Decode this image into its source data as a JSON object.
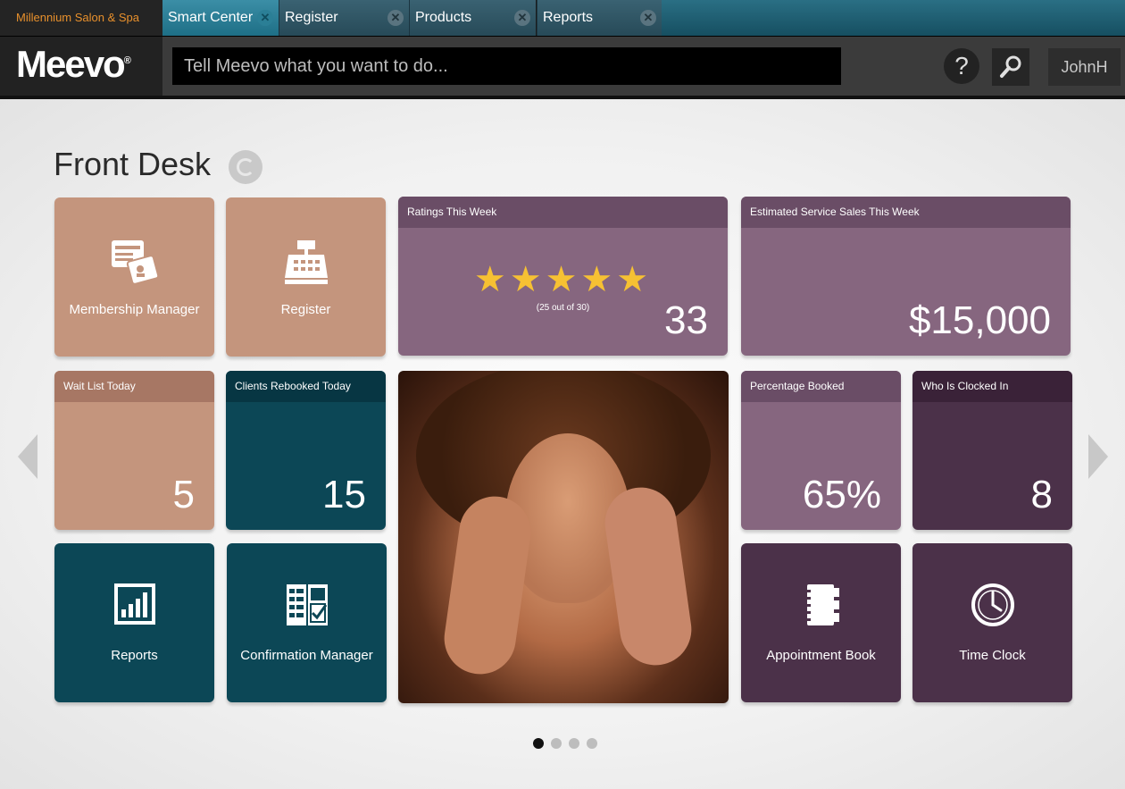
{
  "tabbar": {
    "brand": "Millennium Salon & Spa",
    "tabs": [
      {
        "label": "Smart Center",
        "active": true
      },
      {
        "label": "Register",
        "active": false
      },
      {
        "label": "Products",
        "active": false
      },
      {
        "label": "Reports",
        "active": false
      }
    ]
  },
  "header": {
    "logo": "Meevo",
    "logo_mark": "®",
    "command_placeholder": "Tell Meevo what you want to do...",
    "help_label": "?",
    "user": "JohnH"
  },
  "page": {
    "title": "Front Desk"
  },
  "tiles": {
    "membership_manager": {
      "label": "Membership Manager"
    },
    "register": {
      "label": "Register"
    },
    "ratings": {
      "title": "Ratings This Week",
      "stars": "★★★★★",
      "rating": 5,
      "subtitle": "(25 out of 30)",
      "value": "33"
    },
    "service_sales": {
      "title": "Estimated Service Sales This Week",
      "value": "$15,000"
    },
    "wait_list": {
      "title": "Wait List Today",
      "value": "5"
    },
    "rebooked": {
      "title": "Clients Rebooked Today",
      "value": "15"
    },
    "percentage_booked": {
      "title": "Percentage Booked",
      "value": "65%"
    },
    "clocked_in": {
      "title": "Who Is Clocked In",
      "value": "8"
    },
    "reports": {
      "label": "Reports"
    },
    "confirmation_manager": {
      "label": "Confirmation Manager"
    },
    "appointment_book": {
      "label": "Appointment Book"
    },
    "time_clock": {
      "label": "Time Clock"
    }
  },
  "pagination": {
    "pages": 4,
    "current": 1
  },
  "colors": {
    "tan": "#c4957d",
    "purple": "#86667f",
    "teal": "#0c4756",
    "plum": "#4b3149",
    "star": "#f6c133",
    "brand_accent": "#e8902c"
  }
}
